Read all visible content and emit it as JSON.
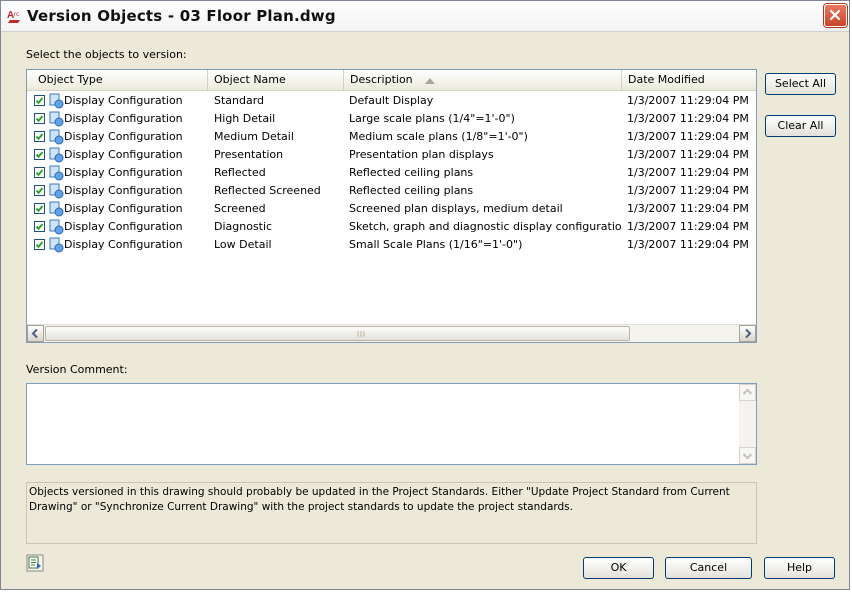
{
  "window": {
    "title": "Version Objects - 03 Floor Plan.dwg"
  },
  "prompt_label": "Select the objects to version:",
  "columns": [
    "Object Type",
    "Object Name",
    "Description",
    "Date Modified"
  ],
  "rows": [
    {
      "type": "Display Configuration",
      "name": "Standard",
      "description": "Default Display",
      "date": "1/3/2007 11:29:04 PM",
      "checked": true
    },
    {
      "type": "Display Configuration",
      "name": "High Detail",
      "description": "Large scale plans (1/4\"=1'-0\")",
      "date": "1/3/2007 11:29:04 PM",
      "checked": true
    },
    {
      "type": "Display Configuration",
      "name": "Medium Detail",
      "description": "Medium scale plans (1/8\"=1'-0\")",
      "date": "1/3/2007 11:29:04 PM",
      "checked": true
    },
    {
      "type": "Display Configuration",
      "name": "Presentation",
      "description": "Presentation plan displays",
      "date": "1/3/2007 11:29:04 PM",
      "checked": true
    },
    {
      "type": "Display Configuration",
      "name": "Reflected",
      "description": "Reflected ceiling plans",
      "date": "1/3/2007 11:29:04 PM",
      "checked": true
    },
    {
      "type": "Display Configuration",
      "name": "Reflected Screened",
      "description": "Reflected ceiling plans",
      "date": "1/3/2007 11:29:04 PM",
      "checked": true
    },
    {
      "type": "Display Configuration",
      "name": "Screened",
      "description": "Screened plan displays, medium detail",
      "date": "1/3/2007 11:29:04 PM",
      "checked": true
    },
    {
      "type": "Display Configuration",
      "name": "Diagnostic",
      "description": "Sketch, graph and diagnostic display configuratio...",
      "date": "1/3/2007 11:29:04 PM",
      "checked": true
    },
    {
      "type": "Display Configuration",
      "name": "Low Detail",
      "description": "Small Scale Plans (1/16\"=1'-0\")",
      "date": "1/3/2007 11:29:04 PM",
      "checked": true
    }
  ],
  "buttons": {
    "select_all": "Select All",
    "clear_all": "Clear All",
    "ok": "OK",
    "cancel": "Cancel",
    "help": "Help"
  },
  "version_comment_label": "Version Comment:",
  "version_comment_value": "",
  "info_text": "Objects versioned in this drawing should probably be updated in the Project Standards. Either \"Update Project Standard from Current Drawing\" or \"Synchronize Current Drawing\" with the project standards to update the project standards.",
  "colors": {
    "dialog_bg": "#ece9d8",
    "check_green": "#21a121",
    "close_red": "#d9553a"
  },
  "icons": {
    "title": "autocad-architecture-icon",
    "close": "close-icon",
    "row": "display-configuration-icon",
    "sort": "sort-ascending-icon",
    "bottom": "standards-icon"
  }
}
